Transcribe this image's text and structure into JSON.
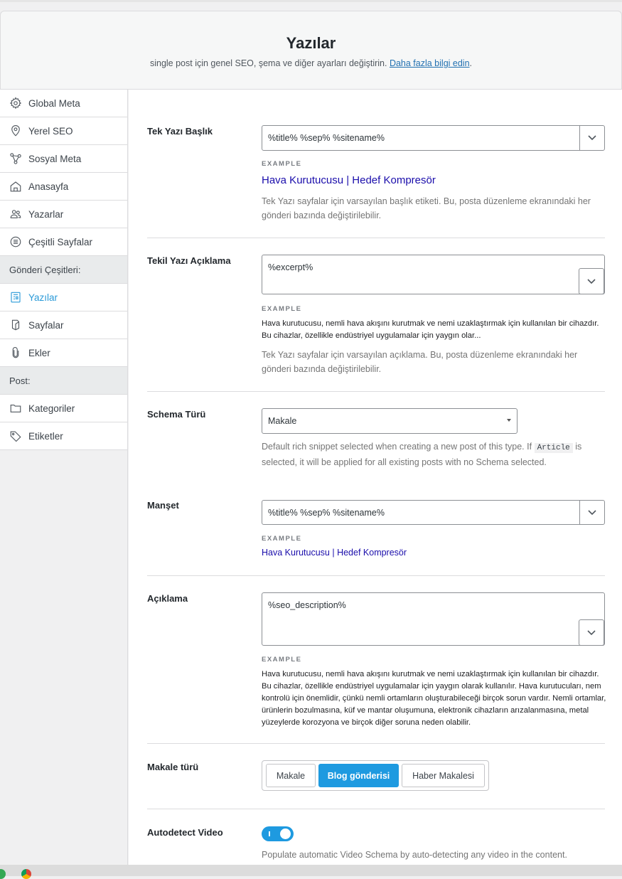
{
  "header": {
    "title": "Yazılar",
    "subtitle": "single post için genel SEO, şema ve diğer ayarları değiştirin.",
    "link": "Daha fazla bilgi edin",
    "period": "."
  },
  "sidebar": {
    "items_top": [
      {
        "label": "Global Meta",
        "icon": "gear-icon"
      },
      {
        "label": "Yerel SEO",
        "icon": "location-pin-icon"
      },
      {
        "label": "Sosyal Meta",
        "icon": "share-icon"
      },
      {
        "label": "Anasayfa",
        "icon": "home-icon"
      },
      {
        "label": "Yazarlar",
        "icon": "users-icon"
      },
      {
        "label": "Çeşitli Sayfalar",
        "icon": "list-circle-icon"
      }
    ],
    "heading_post_types": "Gönderi Çeşitleri:",
    "items_post_types": [
      {
        "label": "Yazılar",
        "icon": "document-icon",
        "active": true
      },
      {
        "label": "Sayfalar",
        "icon": "page-icon"
      },
      {
        "label": "Ekler",
        "icon": "paperclip-icon"
      }
    ],
    "heading_post": "Post:",
    "items_post": [
      {
        "label": "Kategoriler",
        "icon": "folder-icon"
      },
      {
        "label": "Etiketler",
        "icon": "tag-icon"
      }
    ]
  },
  "main": {
    "title_field": {
      "label": "Tek Yazı Başlık",
      "value": "%title% %sep% %sitename%",
      "example_label": "EXAMPLE",
      "example": "Hava Kurutucusu | Hedef Kompresör",
      "help": "Tek Yazı sayfalar için varsayılan başlık etiketi. Bu, posta düzenleme ekranındaki her gönderi bazında değiştirilebilir."
    },
    "desc_field": {
      "label": "Tekil Yazı Açıklama",
      "value": "%excerpt%",
      "example_label": "EXAMPLE",
      "example": "Hava kurutucusu, nemli hava akışını kurutmak ve nemi uzaklaştırmak için kullanılan bir cihazdır. Bu cihazlar, özellikle endüstriyel uygulamalar için yaygın olar...",
      "help": "Tek Yazı sayfalar için varsayılan açıklama. Bu, posta düzenleme ekranındaki her gönderi bazında değiştirilebilir."
    },
    "schema_field": {
      "label": "Schema Türü",
      "selected": "Makale",
      "help_before": "Default rich snippet selected when creating a new post of this type. If",
      "help_code": "Article",
      "help_after": "is selected, it will be applied for all existing posts with no Schema selected."
    },
    "headline_field": {
      "label": "Manşet",
      "value": "%title% %sep% %sitename%",
      "example_label": "EXAMPLE",
      "example": "Hava Kurutucusu | Hedef Kompresör"
    },
    "description_field": {
      "label": "Açıklama",
      "value": "%seo_description%",
      "example_label": "EXAMPLE",
      "example": "Hava kurutucusu, nemli hava akışını kurutmak ve nemi uzaklaştırmak için kullanılan bir cihazdır. Bu cihazlar, özellikle endüstriyel uygulamalar için yaygın olarak kullanılır. Hava kurutucuları, nem kontrolü için önemlidir, çünkü nemli ortamların oluşturabileceği birçok sorun vardır. Nemli ortamlar, ürünlerin bozulmasına, küf ve mantar oluşumuna, elektronik cihazların arızalanmasına, metal yüzeylerde korozyona ve birçok diğer soruna neden olabilir."
    },
    "article_type": {
      "label": "Makale türü",
      "options": [
        "Makale",
        "Blog gönderisi",
        "Haber Makalesi"
      ],
      "selected": "Blog gönderisi"
    },
    "autodetect_video": {
      "label": "Autodetect Video",
      "enabled": true,
      "help": "Populate automatic Video Schema by auto-detecting any video in the content."
    }
  },
  "colors": {
    "accent": "#1e9ae0",
    "example_link": "#1a0dab",
    "active_sidebar": "#2a9ad8"
  }
}
